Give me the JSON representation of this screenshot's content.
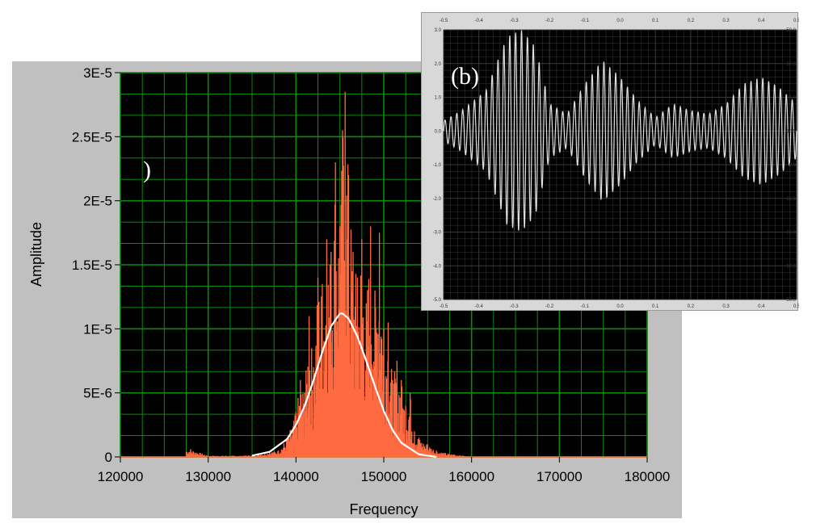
{
  "panel_a_label": ")",
  "panel_b_label": "(b)",
  "colors": {
    "plot_bg": "#000000",
    "grid": "#0b8a0b",
    "spectrum": "#ff6a40",
    "fit": "#ffffff",
    "frame_bg": "#c0c0c0",
    "inset_trace": "#e0e0e0"
  },
  "chart_data": [
    {
      "type": "line",
      "title": "",
      "xlabel": "Frequency",
      "ylabel": "Amplitude",
      "xlim": [
        120000,
        180000
      ],
      "ylim": [
        0,
        3e-05
      ],
      "x_ticks": [
        "120000",
        "130000",
        "140000",
        "150000",
        "160000",
        "170000",
        "180000"
      ],
      "y_ticks": [
        "0",
        "5E-6",
        "1E-5",
        "1.5E-5",
        "2E-5",
        "2.5E-5",
        "3E-5"
      ],
      "grid": true,
      "series": [
        {
          "x": [
            128000,
            130000,
            132000,
            134000,
            136000,
            137000,
            138000,
            139000,
            140000,
            140500,
            141000,
            141500,
            142000,
            142500,
            143000,
            143500,
            144000,
            144500,
            145000,
            145300,
            145600,
            146000,
            146500,
            147000,
            147500,
            148000,
            148500,
            149000,
            149500,
            150000,
            150500,
            151000,
            151500,
            152000,
            152500,
            153000,
            153500,
            154000,
            155000,
            156000,
            157000,
            158000,
            159000,
            160000
          ],
          "y": [
            6e-07,
            1e-07,
            1e-07,
            1e-07,
            2e-07,
            4e-07,
            5e-07,
            1.5e-06,
            3.5e-06,
            6e-06,
            5e-06,
            1.1e-05,
            7e-06,
            1.4e-05,
            1.35e-05,
            1.7e-05,
            1.6e-05,
            2.3e-05,
            1.8e-05,
            2.55e-05,
            2.85e-05,
            2.2e-05,
            1.6e-05,
            1.4e-05,
            1.7e-05,
            1.2e-05,
            1.8e-05,
            1.3e-05,
            1.75e-05,
            1e-05,
            1.05e-05,
            6e-06,
            7.5e-06,
            6e-06,
            4e-06,
            5e-06,
            2e-06,
            1.5e-06,
            1e-06,
            5e-07,
            3e-07,
            2e-07,
            1e-07,
            0
          ]
        },
        {
          "x": [
            135000,
            137000,
            139000,
            140000,
            141000,
            142000,
            143000,
            144000,
            145000,
            145300,
            146000,
            147000,
            148000,
            149000,
            150000,
            151000,
            152000,
            154000,
            156000
          ],
          "y": [
            1e-07,
            4e-07,
            1.4e-06,
            2.5e-06,
            4e-06,
            6e-06,
            8.2e-06,
            1.02e-05,
            1.12e-05,
            1.12e-05,
            1.08e-05,
            9.4e-06,
            7.5e-06,
            5.5e-06,
            3.6e-06,
            2.1e-06,
            1.1e-06,
            2e-07,
            0
          ]
        }
      ]
    },
    {
      "type": "line",
      "title": "",
      "xlabel": "",
      "ylabel": "",
      "x_ticks_bottom": [
        "-0.5",
        "-0.4",
        "-0.3",
        "-0.2",
        "-0.1",
        "0.0",
        "0.1",
        "0.2",
        "0.3",
        "0.4",
        "0.5"
      ],
      "x_ticks_top": [
        "-0.5",
        "-0.4",
        "-0.3",
        "-0.2",
        "-0.1",
        "0.0",
        "0.1",
        "0.2",
        "0.3",
        "0.4",
        "0.5"
      ],
      "y_ticks_left": [
        "3.0",
        "2.0",
        "1.0",
        "0.0",
        "-1.0",
        "-2.0",
        "-3.0",
        "-4.0",
        "-5.0"
      ],
      "y_ticks_right": [
        "50.0",
        "37.5",
        "25.0",
        "12.5",
        "0.0",
        "-12.5",
        "-25.0",
        "-37.5",
        "-50.0"
      ],
      "xlim": [
        -0.5,
        0.5
      ],
      "ylim": [
        -5,
        3
      ],
      "grid": true,
      "series": [
        {
          "envelope_x": [
            -0.5,
            -0.45,
            -0.38,
            -0.32,
            -0.28,
            -0.24,
            -0.2,
            -0.15,
            -0.1,
            -0.05,
            0.0,
            0.05,
            0.1,
            0.15,
            0.2,
            0.25,
            0.3,
            0.35,
            0.4,
            0.45,
            0.5
          ],
          "envelope_y": [
            0.3,
            0.6,
            1.2,
            2.8,
            3.0,
            2.5,
            0.8,
            0.5,
            1.4,
            2.1,
            1.6,
            0.9,
            0.4,
            0.8,
            0.6,
            0.5,
            0.8,
            1.4,
            1.6,
            1.3,
            0.8
          ],
          "oscillation_cycles": 60
        }
      ]
    }
  ]
}
